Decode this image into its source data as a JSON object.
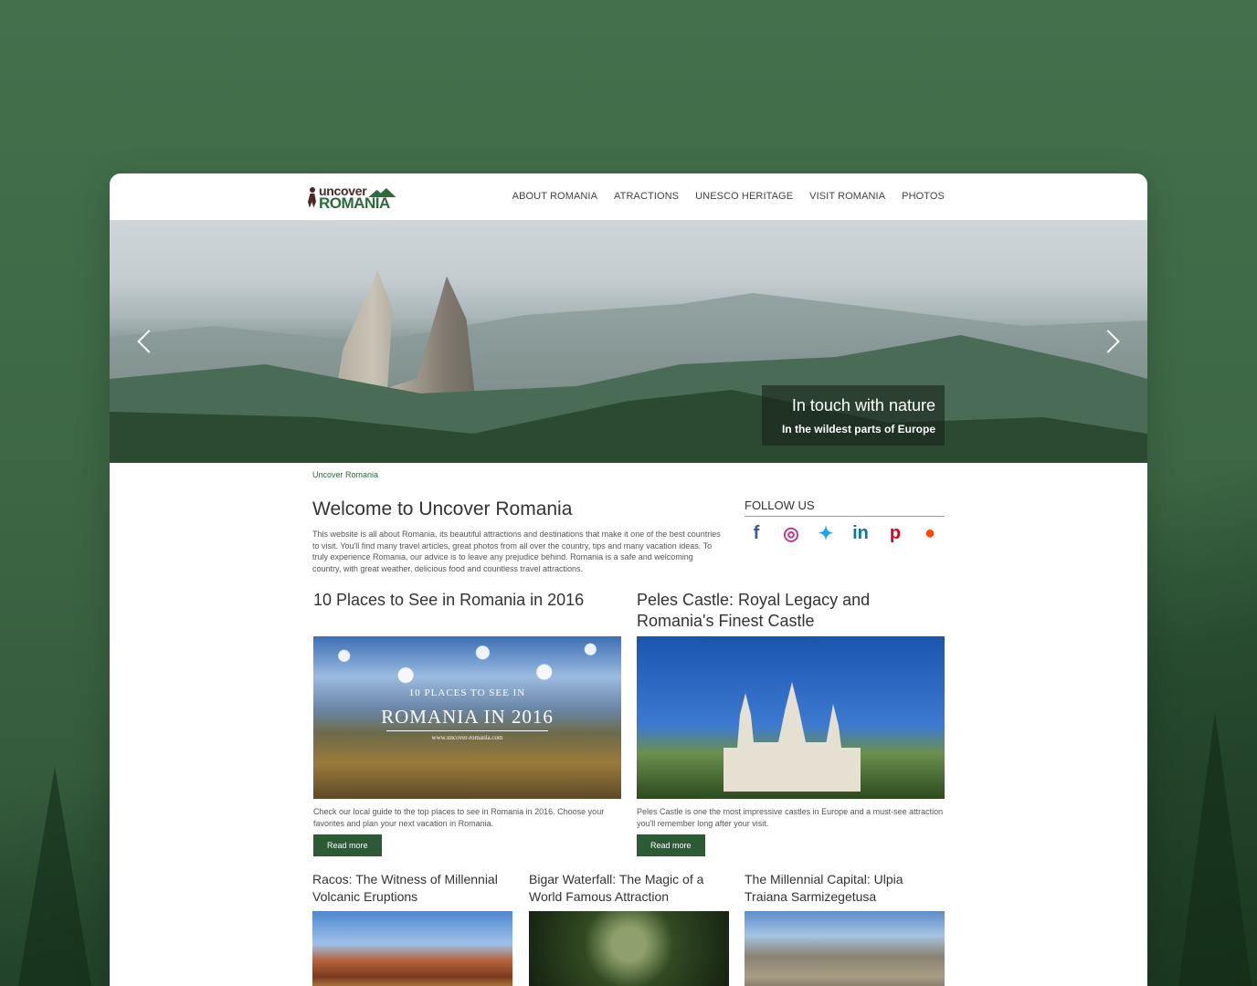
{
  "logo": {
    "top": "uncover",
    "bottom": "ROMANIA"
  },
  "nav": [
    "ABOUT ROMANIA",
    "ATRACTIONS",
    "UNESCO HERITAGE",
    "VISIT ROMANIA",
    "PHOTOS"
  ],
  "hero": {
    "caption_title": "In touch with nature",
    "caption_sub": "In the wildest parts of Europe"
  },
  "breadcrumb": "Uncover Romania",
  "welcome": {
    "title": "Welcome to Uncover Romania",
    "text": "This website is all about Romania, its beautiful attractions and destinations that make it one of the best countries to visit. You'll find many travel articles, great photos from all over the country, tips and many vacation ideas. To truly experience Romania, our advice is to leave any prejudice behind. Romania is a safe and welcoming country, with great weather, delicious food and countless travel attractions."
  },
  "follow": {
    "title": "FOLLOW US",
    "icons": [
      "facebook-icon",
      "instagram-icon",
      "twitter-icon",
      "linkedin-icon",
      "pinterest-icon",
      "reddit-icon"
    ]
  },
  "articles": [
    {
      "title": "10 Places to See in Romania in 2016",
      "image_text_1": "10 PLACES TO SEE IN",
      "image_text_2": "ROMANIA IN 2016",
      "image_text_3": "www.uncover-romania.com",
      "text": "Check our local guide to the top places to see in Romania in 2016. Choose your favorites and plan your next vacation in Romania.",
      "button": "Read more"
    },
    {
      "title": "Peles Castle: Royal Legacy and Romania's Finest Castle",
      "text": "Peles Castle is one the most impressive castles in Europe and a must-see attraction you'll remember long after your visit.",
      "button": "Read more"
    }
  ],
  "small_articles": [
    {
      "title": "Racos: The Witness of Millennial Volcanic Eruptions"
    },
    {
      "title": "Bigar Waterfall: The Magic of a World Famous Attraction"
    },
    {
      "title": "The Millennial Capital: Ulpia Traiana Sarmizegetusa"
    }
  ],
  "colors": {
    "background": "#3f6a47",
    "accent": "#2b5a35"
  }
}
